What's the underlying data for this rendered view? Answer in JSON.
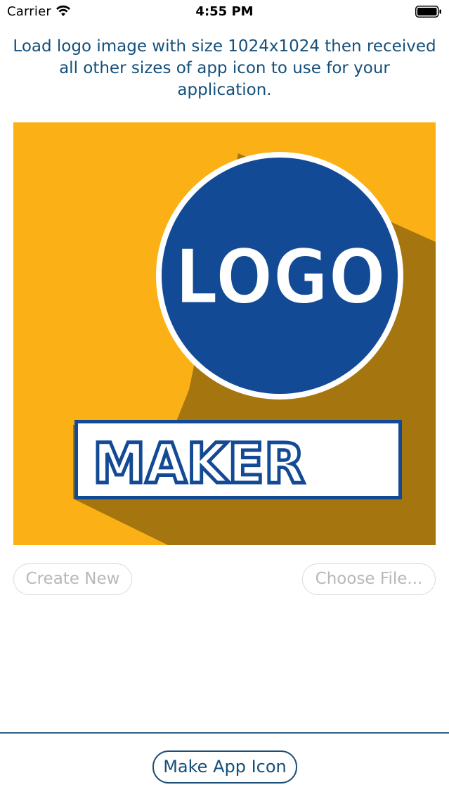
{
  "status_bar": {
    "carrier": "Carrier",
    "time": "4:55 PM",
    "wifi_icon": "wifi-icon",
    "battery_icon": "battery-icon"
  },
  "instruction": "Load logo image with size 1024x1024 then received all other sizes of app icon to use for your application.",
  "preview": {
    "logo_text": "LOGO",
    "maker_text": "MAKER",
    "background_color": "#fbb116",
    "circle_color": "#134a95",
    "shadow_color": "#a57510"
  },
  "buttons": {
    "create_new": "Create New",
    "choose_file": "Choose File...",
    "make_app_icon": "Make App Icon"
  },
  "colors": {
    "text_primary": "#144f7a",
    "disabled_text": "#b8b8b8"
  }
}
